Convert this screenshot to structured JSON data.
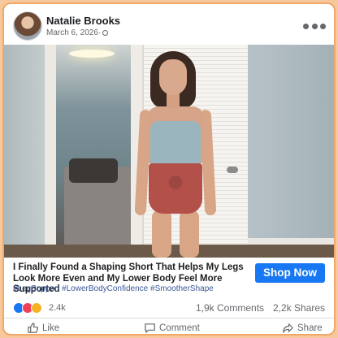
{
  "post": {
    "author": "Natalie Brooks",
    "date": "March 6, 2026",
    "date_separator": "·"
  },
  "ad": {
    "headline": "I Finally Found a Shaping Short That Helps My Legs Look More Even and My Lower Body Feel More Supported",
    "hashtags": "#LegSupport #LowerBodyConfidence #SmootherShape",
    "cta_label": "Shop Now"
  },
  "stats": {
    "reactions": "2.4k",
    "comments": "1,9k Comments",
    "shares": "2,2k Shares"
  },
  "actions": {
    "like": "Like",
    "comment": "Comment",
    "share": "Share"
  },
  "icons": {
    "more": "more-dots-icon",
    "audience": "globe-icon",
    "like": "thumbs-up-icon",
    "comment": "speech-bubble-icon",
    "share": "share-arrow-icon"
  },
  "colors": {
    "accent": "#1877f2",
    "frame_border": "#f0a86a",
    "background": "#f6c89c"
  }
}
